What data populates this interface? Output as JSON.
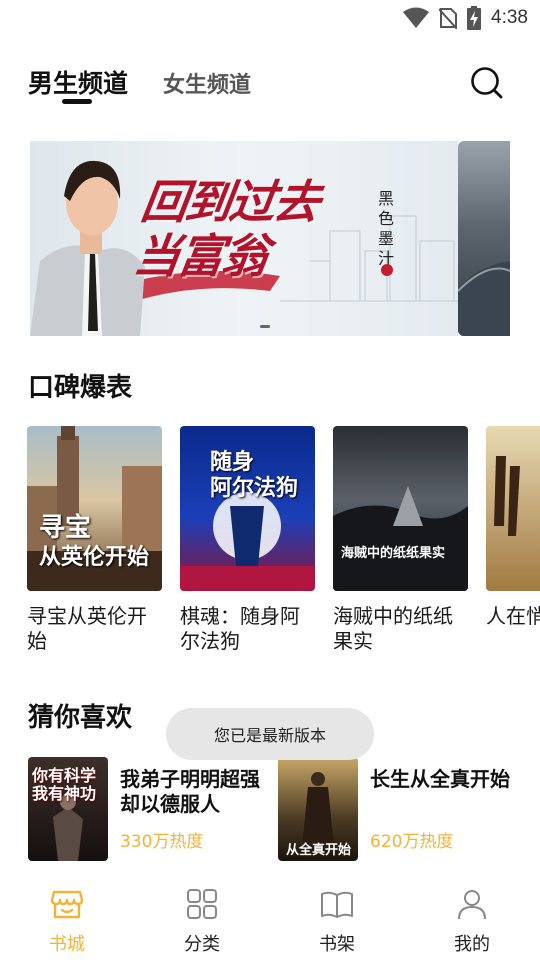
{
  "status_bar": {
    "time": "4:38",
    "icons": [
      "wifi-icon",
      "no-sim-icon",
      "battery-charging-icon"
    ]
  },
  "header": {
    "tabs": [
      {
        "label": "男生频道",
        "active": true
      },
      {
        "label": "女生频道",
        "active": false
      }
    ],
    "search_icon": "search-icon"
  },
  "banner": {
    "title_line1": "回到过去",
    "title_line2": "当富翁",
    "author": "黑色墨汁"
  },
  "sections": {
    "reputation": {
      "title": "口碑爆表",
      "books": [
        {
          "title": "寻宝从英伦开始",
          "cover_text": "寻宝\n从英伦开始"
        },
        {
          "title": "棋魂：随身阿尔法狗",
          "cover_text": "随身\n阿尔法狗"
        },
        {
          "title": "海贼中的纸纸果实",
          "cover_text": "海贼中的纸纸果实"
        },
        {
          "title": "人在悄悄",
          "cover_text": ""
        }
      ]
    },
    "guess": {
      "title": "猜你喜欢",
      "books": [
        {
          "title": "我弟子明明超强却以德服人",
          "heat": "330万热度",
          "cover_text": "你有科学\n我有神功"
        },
        {
          "title": "长生从全真开始",
          "heat": "620万热度",
          "cover_text": "从全真开始"
        }
      ]
    }
  },
  "toast": {
    "text": "您已是最新版本"
  },
  "bottom_nav": {
    "items": [
      {
        "label": "书城",
        "icon": "bookstore-icon",
        "active": true
      },
      {
        "label": "分类",
        "icon": "category-grid-icon",
        "active": false
      },
      {
        "label": "书架",
        "icon": "bookshelf-icon",
        "active": false
      },
      {
        "label": "我的",
        "icon": "profile-icon",
        "active": false
      }
    ]
  },
  "colors": {
    "accent": "#f5b335",
    "banner_title": "#b3122a",
    "toast_bg": "#e6e6e6"
  }
}
